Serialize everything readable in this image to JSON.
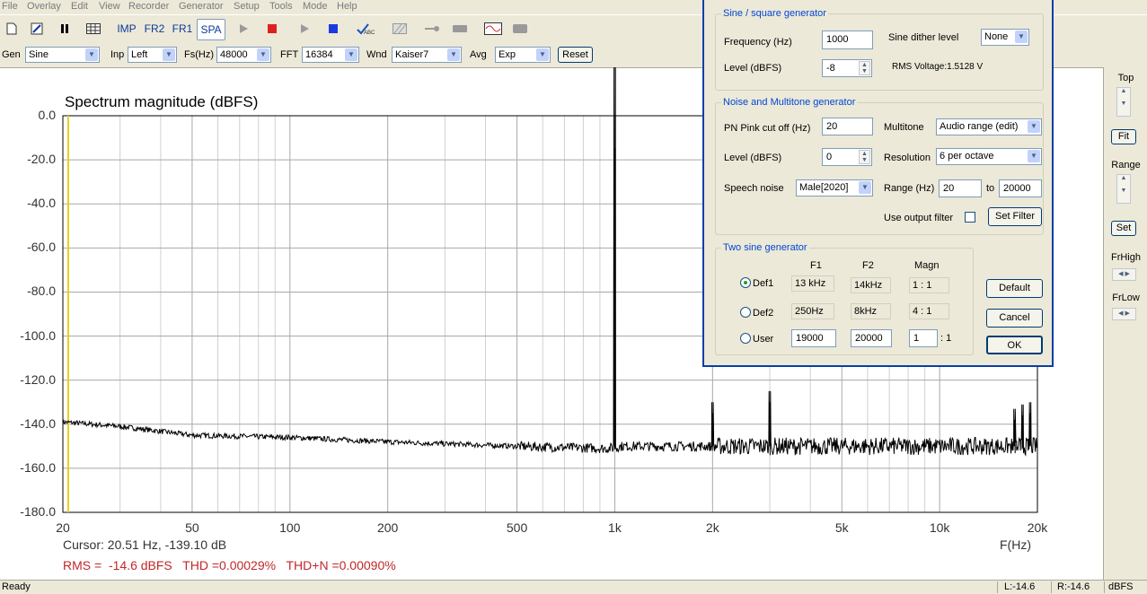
{
  "menu": [
    "File",
    "Overlay",
    "Edit",
    "View",
    "Recorder",
    "Generator",
    "Setup",
    "Tools",
    "Mode",
    "Help"
  ],
  "toolbar": {
    "modes": [
      "IMP",
      "FR2",
      "FR1",
      "SPA"
    ],
    "active_mode": "SPA"
  },
  "controls": {
    "gen_label": "Gen",
    "gen_value": "Sine",
    "inp_label": "Inp",
    "inp_value": "Left",
    "fs_label": "Fs(Hz)",
    "fs_value": "48000",
    "fft_label": "FFT",
    "fft_value": "16384",
    "wnd_label": "Wnd",
    "wnd_value": "Kaiser7",
    "avg_label": "Avg",
    "avg_value": "Exp",
    "reset_label": "Reset"
  },
  "right_panel": {
    "top_label": "Top",
    "fit_label": "Fit",
    "range_label": "Range",
    "set_label": "Set",
    "frhigh_label": "FrHigh",
    "frlow_label": "FrLow"
  },
  "dialog": {
    "sine_group_title": "Sine / square generator",
    "frequency_label": "Frequency (Hz)",
    "frequency_value": "1000",
    "dither_label": "Sine dither level",
    "dither_value": "None",
    "level_label": "Level (dBFS)",
    "level_value": "-8",
    "rms_voltage": "RMS Voltage:1.5128 V",
    "noise_group_title": "Noise and Multitone generator",
    "pink_label": "PN Pink cut off (Hz)",
    "pink_value": "20",
    "multitone_label": "Multitone",
    "multitone_value": "Audio range (edit)",
    "noise_level_label": "Level (dBFS)",
    "noise_level_value": "0",
    "resolution_label": "Resolution",
    "resolution_value": "6 per octave",
    "speech_label": "Speech noise",
    "speech_value": "Male[2020]",
    "range_label": "Range (Hz)",
    "range_from": "20",
    "range_to_label": "to",
    "range_to": "20000",
    "output_filter_label": "Use output filter",
    "output_filter_checked": false,
    "set_filter_label": "Set Filter",
    "two_sine_title": "Two sine generator",
    "col_f1": "F1",
    "col_f2": "F2",
    "col_magn": "Magn",
    "rows": [
      {
        "label": "Def1",
        "f1": "13 kHz",
        "f2": "14kHz",
        "magn": "1 : 1",
        "selected": true
      },
      {
        "label": "Def2",
        "f1": "250Hz",
        "f2": "8kHz",
        "magn": "4 : 1",
        "selected": false
      },
      {
        "label": "User",
        "f1": "19000",
        "f2": "20000",
        "magn": "1",
        "magn_suffix": ": 1",
        "selected": false
      }
    ],
    "default_label": "Default",
    "cancel_label": "Cancel",
    "ok_label": "OK"
  },
  "chart_data": {
    "type": "line",
    "title": "Spectrum magnitude (dBFS)",
    "xlabel": "F(Hz)",
    "ylabel": "",
    "x_scale": "log",
    "xlim": [
      20,
      20000
    ],
    "ylim": [
      -180,
      0
    ],
    "x_ticks": [
      {
        "v": 20,
        "t": "20"
      },
      {
        "v": 50,
        "t": "50"
      },
      {
        "v": 100,
        "t": "100"
      },
      {
        "v": 200,
        "t": "200"
      },
      {
        "v": 500,
        "t": "500"
      },
      {
        "v": 1000,
        "t": "1k"
      },
      {
        "v": 2000,
        "t": "2k"
      },
      {
        "v": 5000,
        "t": "5k"
      },
      {
        "v": 10000,
        "t": "10k"
      },
      {
        "v": 20000,
        "t": "20k"
      }
    ],
    "y_ticks": [
      {
        "v": 0,
        "t": "0.0"
      },
      {
        "v": -20,
        "t": "-20.0"
      },
      {
        "v": -40,
        "t": "-40.0"
      },
      {
        "v": -60,
        "t": "-60.0"
      },
      {
        "v": -80,
        "t": "-80.0"
      },
      {
        "v": -100,
        "t": "-100.0"
      },
      {
        "v": -120,
        "t": "-120.0"
      },
      {
        "v": -140,
        "t": "-140.0"
      },
      {
        "v": -160,
        "t": "-160.0"
      },
      {
        "v": -180,
        "t": "-180.0"
      }
    ],
    "grid": true,
    "cursor_marker_hz": 20.51,
    "series": [
      {
        "noise_floor": [
          [
            20,
            -139
          ],
          [
            30,
            -141
          ],
          [
            50,
            -145
          ],
          [
            100,
            -146
          ],
          [
            200,
            -148
          ],
          [
            500,
            -150
          ],
          [
            950,
            -151
          ],
          [
            1050,
            -150
          ],
          [
            2000,
            -150
          ],
          [
            5000,
            -150
          ],
          [
            10000,
            -150
          ],
          [
            20000,
            -150
          ]
        ],
        "peaks": [
          [
            1000,
            -14.6
          ],
          [
            2000,
            -135
          ],
          [
            3000,
            -130
          ],
          [
            17000,
            -138
          ],
          [
            18000,
            -136
          ],
          [
            19000,
            -135
          ]
        ]
      }
    ]
  },
  "readout": {
    "cursor": "Cursor: 20.51 Hz, -139.10 dB",
    "measurements": "RMS =  -14.6 dBFS   THD =0.00029%   THD+N =0.00090%"
  },
  "status": {
    "ready": "Ready",
    "left_level": "L:-14.6",
    "right_level": "R:-14.6",
    "unit": "dBFS"
  }
}
